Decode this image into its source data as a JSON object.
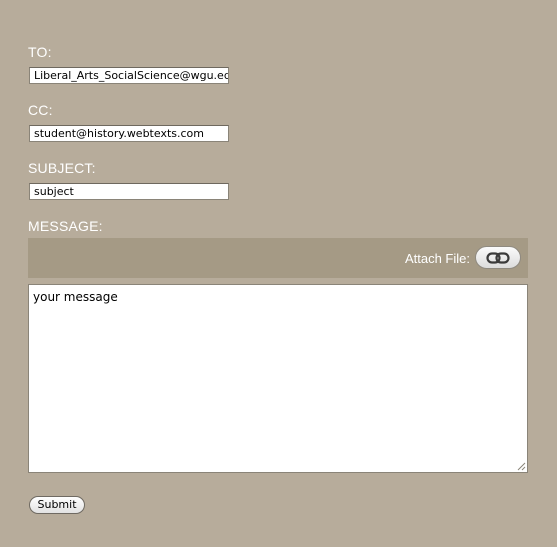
{
  "form": {
    "to": {
      "label": "TO:",
      "value": "Liberal_Arts_SocialScience@wgu.edu"
    },
    "cc": {
      "label": "CC:",
      "value": "student@history.webtexts.com"
    },
    "subject": {
      "label": "SUBJECT:",
      "value": "subject"
    },
    "message": {
      "label": "MESSAGE:",
      "value": "your message"
    },
    "attach": {
      "label": "Attach File:",
      "icon": "link-icon"
    },
    "submit_label": "Submit"
  },
  "colors": {
    "background": "#b7ac9b",
    "attach_bar": "#a59a85",
    "label_text": "#ffffff"
  }
}
